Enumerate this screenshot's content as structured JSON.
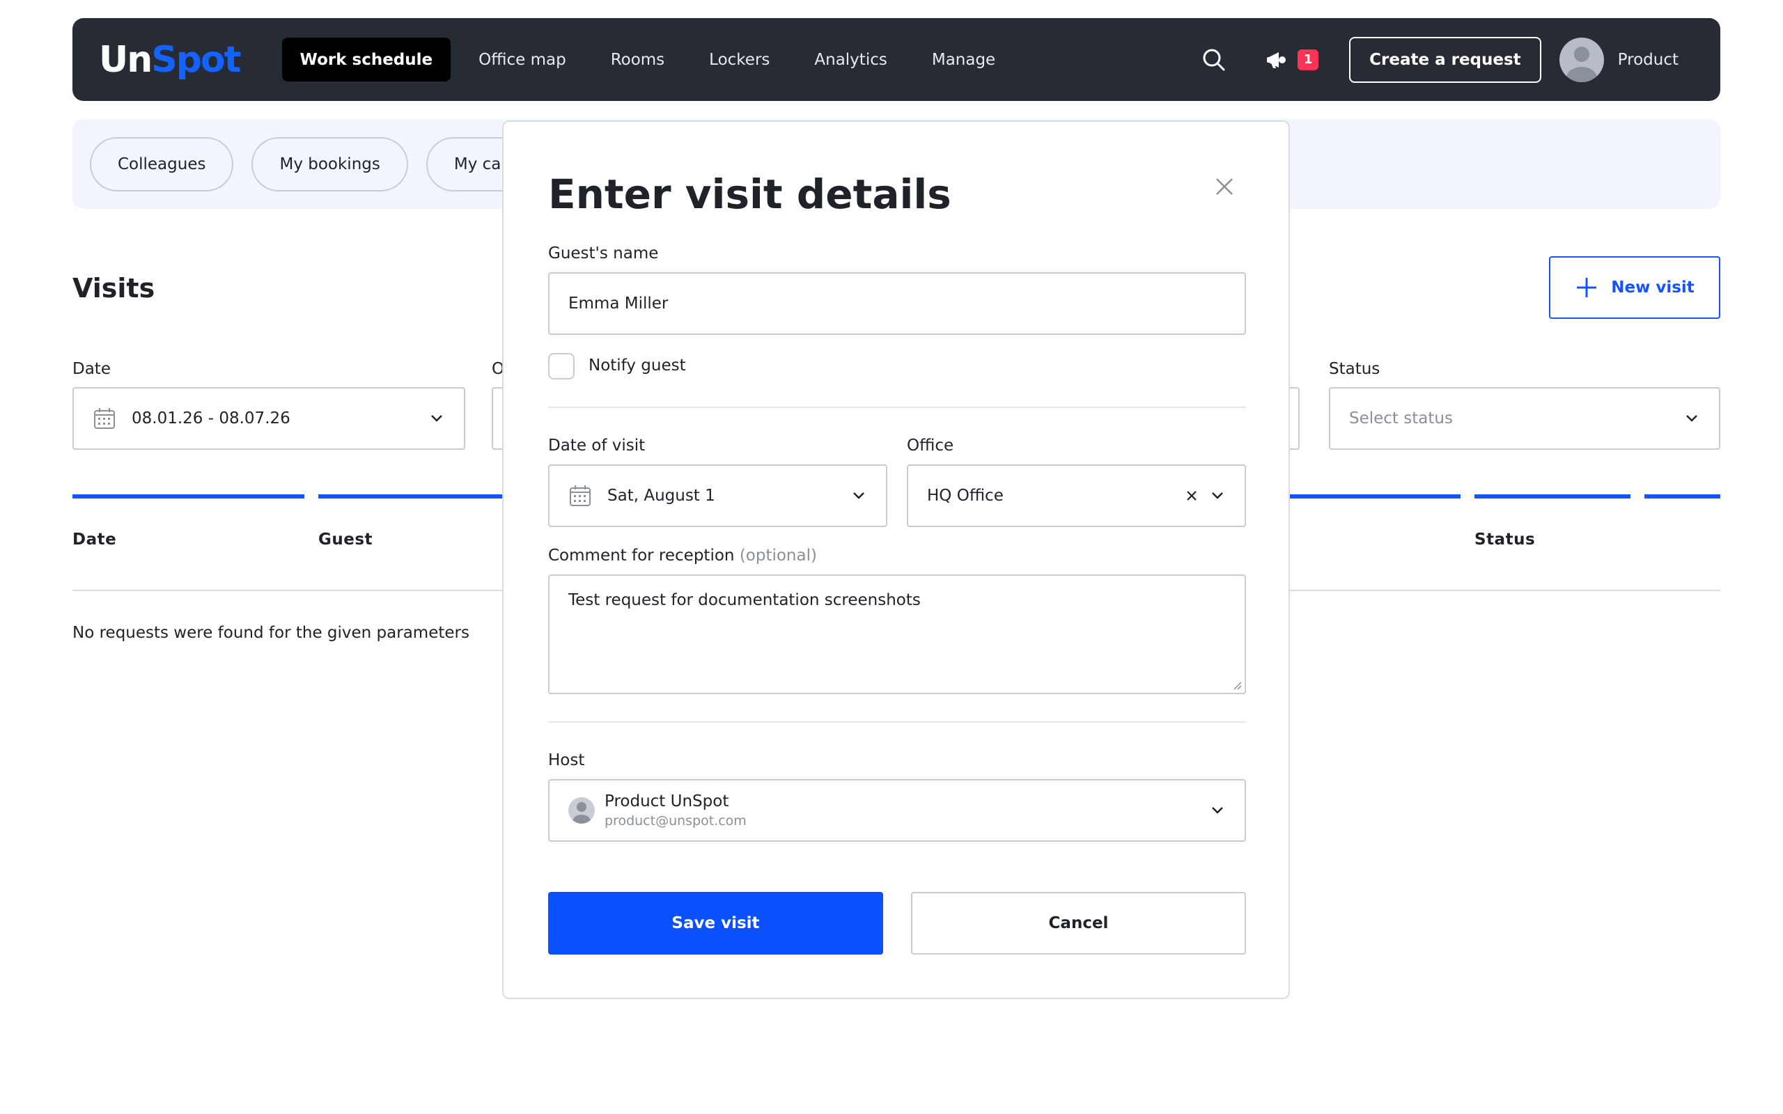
{
  "brand": {
    "logo_part1": "Un",
    "logo_part2": "Spot"
  },
  "nav": {
    "items": [
      {
        "label": "Work schedule",
        "active": true
      },
      {
        "label": "Office map"
      },
      {
        "label": "Rooms"
      },
      {
        "label": "Lockers"
      },
      {
        "label": "Analytics"
      },
      {
        "label": "Manage"
      }
    ]
  },
  "header": {
    "notification_count": "1",
    "create_request_label": "Create a request",
    "user_name": "Product"
  },
  "subtabs": [
    "Colleagues",
    "My bookings",
    "My calendar"
  ],
  "page": {
    "title": "Visits",
    "new_visit_label": "New visit",
    "filters": {
      "date_label": "Date",
      "date_value": "08.01.26 - 08.07.26",
      "office_label": "O",
      "status_label": "Status",
      "status_placeholder": "Select status"
    },
    "columns": {
      "date": "Date",
      "guest": "Guest",
      "status": "Status"
    },
    "empty_message": "No requests were found for the given parameters"
  },
  "modal": {
    "title": "Enter visit details",
    "guest_name_label": "Guest's name",
    "guest_name_value": "Emma Miller",
    "notify_guest_label": "Notify guest",
    "date_label": "Date of visit",
    "date_value": "Sat, August 1",
    "office_label": "Office",
    "office_value": "HQ Office",
    "comment_label": "Comment for reception",
    "comment_optional": "(optional)",
    "comment_value": "Test request for documentation screenshots",
    "host_label": "Host",
    "host_name": "Product UnSpot",
    "host_email": "product@unspot.com",
    "save_label": "Save visit",
    "cancel_label": "Cancel"
  },
  "colors": {
    "accent": "#1553ff",
    "topbar": "#272b33",
    "badge": "#ff3355"
  }
}
